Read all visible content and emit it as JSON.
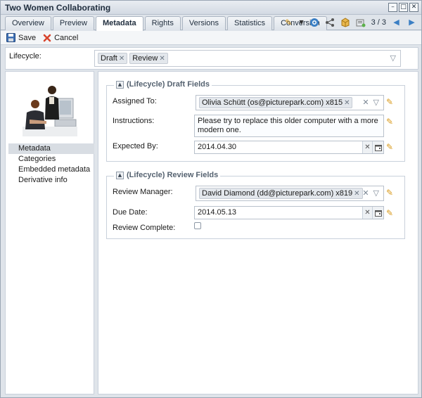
{
  "window": {
    "title": "Two Women Collaborating",
    "buttons": {
      "minimize": "–",
      "restore": "□",
      "close": "✕"
    }
  },
  "tabs": [
    {
      "label": "Overview",
      "active": false
    },
    {
      "label": "Preview",
      "active": false
    },
    {
      "label": "Metadata",
      "active": true
    },
    {
      "label": "Rights",
      "active": false
    },
    {
      "label": "Versions",
      "active": false
    },
    {
      "label": "Statistics",
      "active": false
    },
    {
      "label": "Conversion",
      "active": false
    }
  ],
  "toolbar": {
    "pager": "3 / 3",
    "icons": [
      "pencil-icon",
      "dropdown-icon",
      "help-icon",
      "share-icon",
      "package-icon",
      "export-icon",
      "prev-icon",
      "next-icon"
    ]
  },
  "actions": {
    "save_label": "Save",
    "cancel_label": "Cancel"
  },
  "lifecycle": {
    "label": "Lifecycle:",
    "chips": [
      "Draft",
      "Review"
    ]
  },
  "left_nav": {
    "items": [
      {
        "label": "Metadata",
        "active": true
      },
      {
        "label": "Categories",
        "active": false
      },
      {
        "label": "Embedded metadata",
        "active": false
      },
      {
        "label": "Derivative info",
        "active": false
      }
    ]
  },
  "draft_section": {
    "legend": "(Lifecycle) Draft Fields",
    "assigned_label": "Assigned To:",
    "assigned_value": "Olivia Schütt (os@picturepark.com) x815",
    "instructions_label": "Instructions:",
    "instructions_value": "Please try to replace this older computer with a more modern one.",
    "expected_label": "Expected By:",
    "expected_value": "2014.04.30"
  },
  "review_section": {
    "legend": "(Lifecycle) Review Fields",
    "manager_label": "Review Manager:",
    "manager_value": "David Diamond (dd@picturepark.com) x819",
    "due_label": "Due Date:",
    "due_value": "2014.05.13",
    "complete_label": "Review Complete:",
    "complete_checked": false
  },
  "colors": {
    "accent": "#d99a1b",
    "active_tab_bg": "#ffffff",
    "nav_active_bg": "#d8dde3"
  }
}
